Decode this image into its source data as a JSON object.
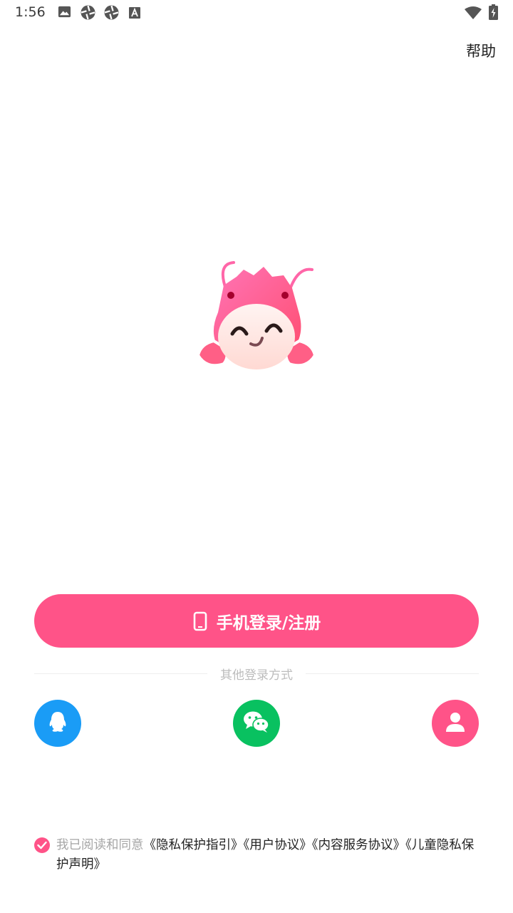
{
  "status_bar": {
    "time": "1:56",
    "left_icons": [
      "image-icon",
      "aperture-icon",
      "aperture-icon",
      "text-a-icon"
    ],
    "right_icons": [
      "wifi-icon",
      "battery-charging-icon"
    ]
  },
  "header": {
    "help_label": "帮助"
  },
  "mascot": {
    "icon": "lobster-mascot-logo"
  },
  "login": {
    "phone_button_label": "手机登录/注册",
    "phone_icon": "phone-icon",
    "other_methods_label": "其他登录方式",
    "methods": [
      {
        "name": "qq",
        "icon": "qq-penguin-icon",
        "color": "#1a9cf6"
      },
      {
        "name": "wechat",
        "icon": "wechat-icon",
        "color": "#09c160"
      },
      {
        "name": "guest",
        "icon": "user-icon",
        "color": "#ff5388"
      }
    ]
  },
  "agreement": {
    "checked": true,
    "prefix": "我已阅读和同意",
    "links": [
      "《隐私保护指引》",
      "《用户协议》",
      "《内容服务协议》",
      "《儿童隐私保护声明》"
    ]
  },
  "colors": {
    "accent": "#ff5388",
    "qq": "#1a9cf6",
    "wechat": "#09c160"
  }
}
